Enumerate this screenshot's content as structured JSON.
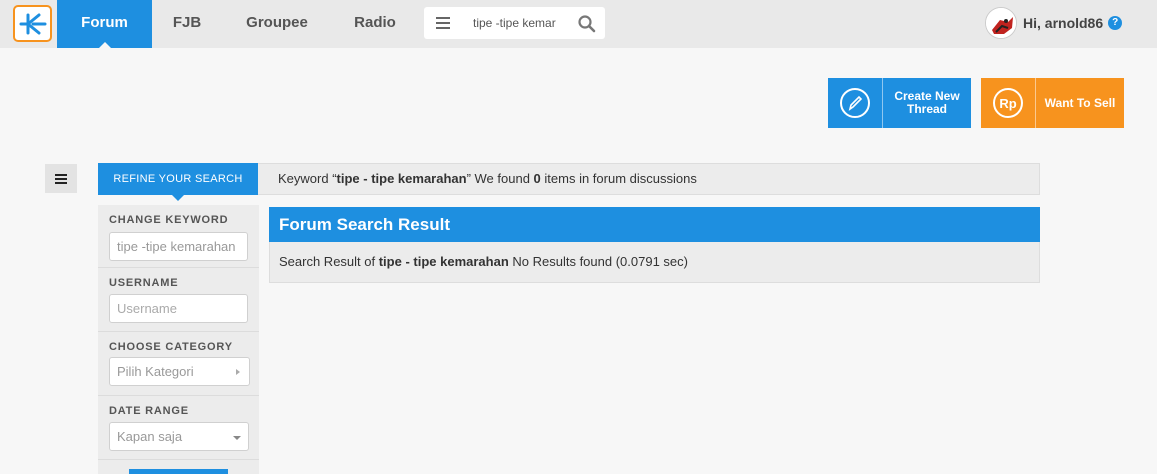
{
  "nav": {
    "logo": "K",
    "items": [
      {
        "label": "Forum",
        "active": true
      },
      {
        "label": "FJB",
        "active": false
      },
      {
        "label": "Groupee",
        "active": false
      },
      {
        "label": "Radio",
        "active": false
      }
    ],
    "search_value": "tipe -tipe kemar",
    "user_greeting": "Hi, arnold86",
    "help": "?"
  },
  "actions": {
    "create_thread": "Create New Thread",
    "want_to_sell": "Want To Sell",
    "rp_icon": "Rp"
  },
  "refine": {
    "tab_label": "REFINE YOUR SEARCH",
    "keyword_prefix": "Keyword “",
    "keyword": "tipe - tipe kemarahan",
    "keyword_mid": "” We found ",
    "count": "0",
    "keyword_suffix": " items in forum discussions"
  },
  "filters": {
    "keyword_label": "CHANGE KEYWORD",
    "keyword_value": "tipe -tipe kemarahan",
    "username_label": "USERNAME",
    "username_placeholder": "Username",
    "category_label": "CHOOSE CATEGORY",
    "category_value": "Pilih Kategori",
    "date_label": "DATE RANGE",
    "date_value": "Kapan saja"
  },
  "results": {
    "title": "Forum Search Result",
    "prefix": "Search Result of ",
    "keyword": "tipe - tipe kemarahan",
    "suffix": " No Results found (0.0791 sec)"
  },
  "colors": {
    "primary": "#1e8fe0",
    "accent": "#f7931e"
  }
}
